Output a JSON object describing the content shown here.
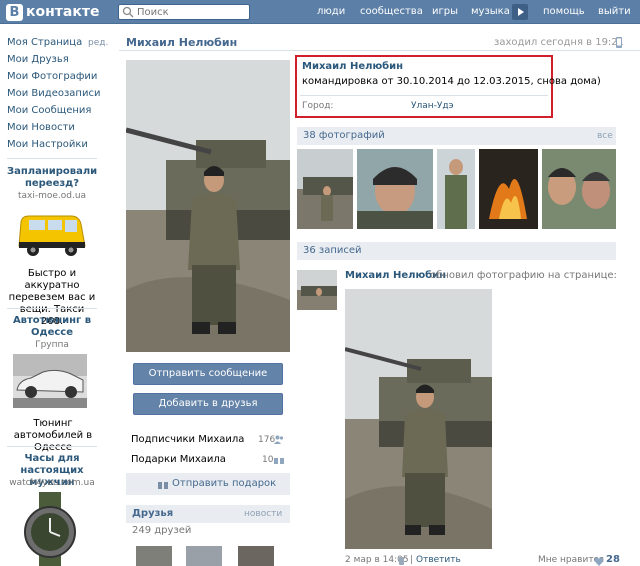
{
  "header": {
    "logo_letter": "В",
    "logo_text": "контакте",
    "search_placeholder": "Поиск",
    "nav": [
      "люди",
      "сообщества",
      "игры",
      "музыка",
      "помощь",
      "выйти"
    ]
  },
  "sidebar": {
    "items": [
      {
        "label": "Моя Страница",
        "extra": "ред."
      },
      {
        "label": "Мои Друзья"
      },
      {
        "label": "Мои Фотографии"
      },
      {
        "label": "Мои Видеозаписи"
      },
      {
        "label": "Мои Сообщения"
      },
      {
        "label": "Мои Новости"
      },
      {
        "label": "Мои Настройки"
      }
    ],
    "ads": [
      {
        "title": "Запланировали переезд?",
        "site": "taxi-moe.od.ua",
        "text": "Быстро и аккуратно перевезем вас и вещи. Такси 268."
      },
      {
        "title": "Автотюнинг в Одессе",
        "sub": "Группа",
        "text": "Тюнинг автомобилей в Одессе"
      },
      {
        "title": "Часы для настоящих мужчин",
        "site": "watch4you.com.ua"
      }
    ]
  },
  "profile": {
    "name": "Михаил Нелюбин",
    "online": "заходил сегодня в 19:21",
    "info_name": "Михаил Нелюбин",
    "status": "командировка от 30.10.2014 до 12.03.2015, снова дома)",
    "city_label": "Город:",
    "city_value": "Улан-Удэ",
    "send_message": "Отправить сообщение",
    "add_friend": "Добавить в друзья",
    "followers_label": "Подписчики Михаила",
    "followers_count": "176",
    "gifts_label": "Подарки Михаила",
    "gifts_count": "10",
    "send_gift": "Отправить подарок",
    "friends_title": "Друзья",
    "friends_news": "новости",
    "friends_count": "249 друзей"
  },
  "photos": {
    "title": "38 фотографий",
    "all": "все"
  },
  "wall": {
    "title": "36 записей",
    "author": "Михаил Нелюбин",
    "action": "обновил фотографию на странице:",
    "date": "2 мар в 14:05",
    "reply": "Ответить",
    "like_label": "Мне нравится",
    "likes": "28"
  }
}
